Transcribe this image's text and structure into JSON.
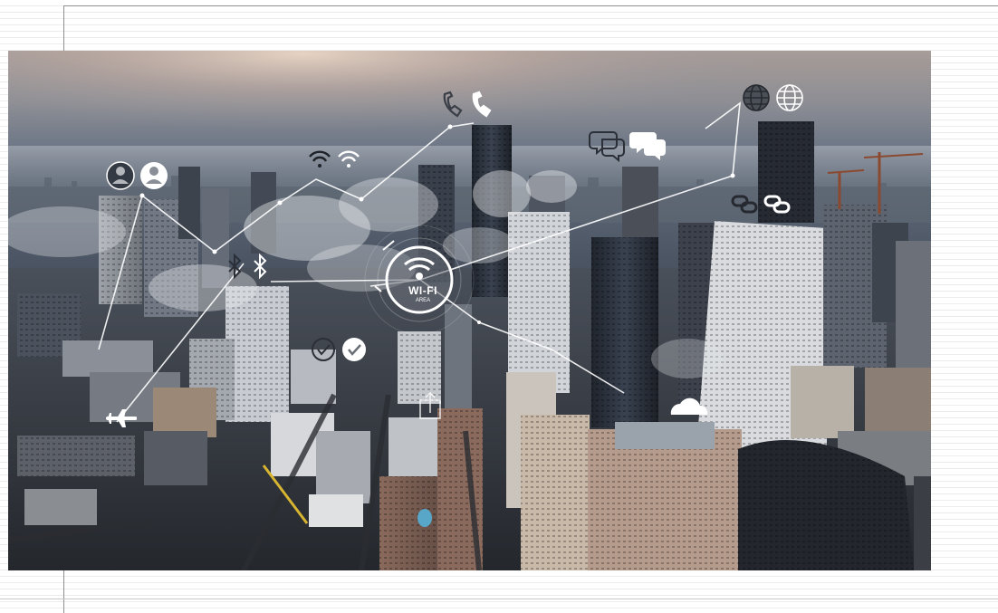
{
  "slide": {
    "wifi_badge": {
      "title": "WI-FI",
      "subtitle": "AREA"
    },
    "icons": [
      "user-icon",
      "wifi-icon",
      "phone-icon",
      "chat-icon",
      "globe-icon",
      "link-icon",
      "bluetooth-icon",
      "check-icon",
      "airplane-icon",
      "cloud-icon",
      "upload-icon"
    ],
    "colors": {
      "background": "#ffffff",
      "rule": "#ececec",
      "frame": "#8f8f8f",
      "icon": "#ffffff"
    }
  }
}
